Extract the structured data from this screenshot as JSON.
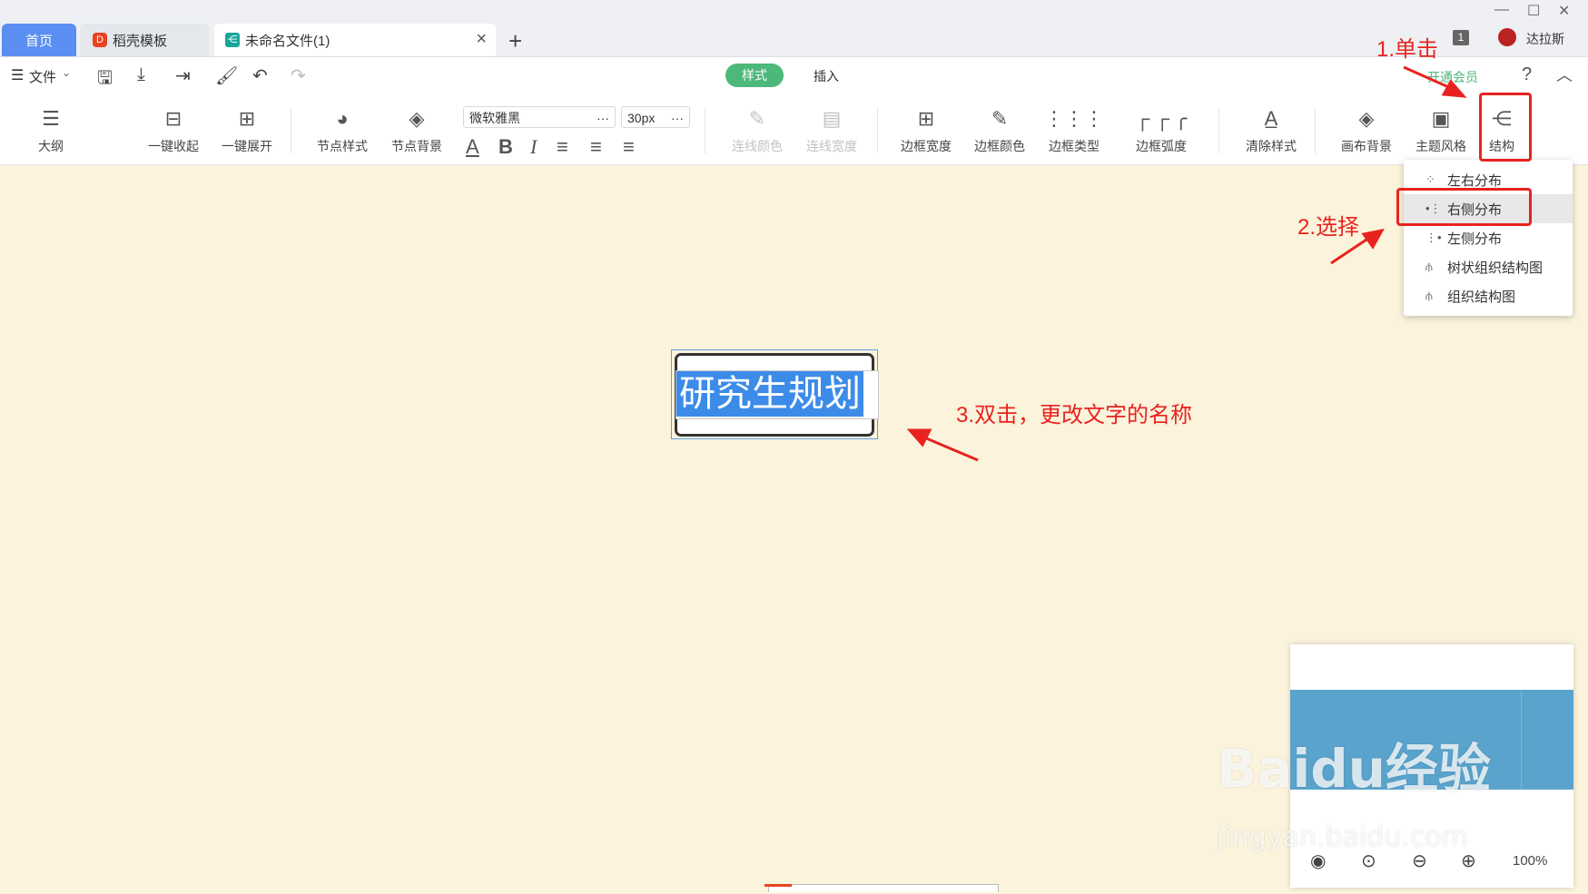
{
  "titlebar": {
    "tabs": [
      {
        "label": "首页",
        "icon": "home"
      },
      {
        "label": "稻壳模板",
        "icon": "docer-icon"
      },
      {
        "label": "未命名文件(1)",
        "icon": "mindmap-icon"
      }
    ],
    "new_tab": "+",
    "notify_count": "1",
    "user": "达拉斯"
  },
  "toolbar1": {
    "file_menu": "文件",
    "tab_style": "样式",
    "tab_insert": "插入",
    "vip": "开通会员",
    "help": "?"
  },
  "toolbar2": {
    "outline": "大纲",
    "collapse_all": "一键收起",
    "expand_all": "一键展开",
    "node_style": "节点样式",
    "node_bg": "节点背景",
    "font_name": "微软雅黑",
    "font_size": "30px",
    "more": "···",
    "line_color": "连线颜色",
    "line_width": "连线宽度",
    "border_width": "边框宽度",
    "border_color": "边框颜色",
    "border_type": "边框类型",
    "border_radius": "边框弧度",
    "clear_style": "清除样式",
    "canvas_bg": "画布背景",
    "theme": "主题风格",
    "structure": "结构"
  },
  "structure_menu": [
    {
      "label": "左右分布",
      "icon": "lr-layout-icon"
    },
    {
      "label": "右侧分布",
      "icon": "right-layout-icon",
      "selected": true
    },
    {
      "label": "左侧分布",
      "icon": "left-layout-icon"
    },
    {
      "label": "树状组织结构图",
      "icon": "tree-org-icon"
    },
    {
      "label": "组织结构图",
      "icon": "org-icon"
    }
  ],
  "canvas": {
    "central_node": "研究生规划"
  },
  "annotations": {
    "step1": "1.单击",
    "step2": "2.选择",
    "step3": "3.双击，更改文字的名称",
    "color": "#e8231f"
  },
  "minimap": {
    "zoom": "100%"
  },
  "watermark": {
    "line1": "Baidu经验",
    "line2": "jingyan.baidu.com"
  },
  "colors": {
    "tab_active": "#5b8ef2",
    "canvas_bg": "#fbf3dc",
    "style_tab": "#4cb87a",
    "selection": "#3d8be8"
  }
}
